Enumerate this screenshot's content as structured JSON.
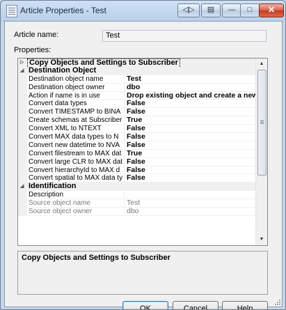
{
  "window": {
    "title": "Article Properties - Test",
    "controls": {
      "extra1": "◁▷",
      "extra2": "▤",
      "minimize": "—",
      "maximize": "□",
      "close": "✕"
    }
  },
  "form": {
    "article_name_label": "Article name:",
    "article_name_value": "Test",
    "properties_label": "Properties:"
  },
  "properties": {
    "rows": [
      {
        "type": "category",
        "label": "Copy Objects and Settings to Subscriber",
        "toggle": "▷",
        "selected": true
      },
      {
        "type": "category",
        "label": "Destination Object",
        "toggle": "◢"
      },
      {
        "type": "prop",
        "name": "Destination object name",
        "value": "Test"
      },
      {
        "type": "prop",
        "name": "Destination object owner",
        "value": "dbo"
      },
      {
        "type": "prop",
        "name": "Action if name is in use",
        "value": "Drop existing object and create a new"
      },
      {
        "type": "prop",
        "name": "Convert data types",
        "value": "False"
      },
      {
        "type": "prop",
        "name": "Convert TIMESTAMP to BINA",
        "value": "False"
      },
      {
        "type": "prop",
        "name": "Create schemas at Subscriber",
        "value": "True"
      },
      {
        "type": "prop",
        "name": "Convert XML to NTEXT",
        "value": "False"
      },
      {
        "type": "prop",
        "name": "Convert MAX data types to N",
        "value": "False"
      },
      {
        "type": "prop",
        "name": "Convert new datetime to NVA",
        "value": "False"
      },
      {
        "type": "prop",
        "name": "Convert filestream to MAX dat",
        "value": "True"
      },
      {
        "type": "prop",
        "name": "Convert large CLR to MAX dat",
        "value": "False"
      },
      {
        "type": "prop",
        "name": "Convert hierarchyId to MAX d",
        "value": "False"
      },
      {
        "type": "prop",
        "name": "Convert spatial to MAX data ty",
        "value": "False"
      },
      {
        "type": "category",
        "label": "Identification",
        "toggle": "◢"
      },
      {
        "type": "prop",
        "name": "Description",
        "value": ""
      },
      {
        "type": "prop",
        "name": "Source object name",
        "value": "Test",
        "readonly": true
      },
      {
        "type": "prop",
        "name": "Source object owner",
        "value": "dbo",
        "readonly": true
      }
    ],
    "scroll_up": "▲",
    "scroll_down": "▼"
  },
  "description_panel": {
    "text": "Copy Objects and Settings to Subscriber"
  },
  "buttons": {
    "ok": "OK",
    "cancel": "Cancel",
    "help": "Help"
  }
}
